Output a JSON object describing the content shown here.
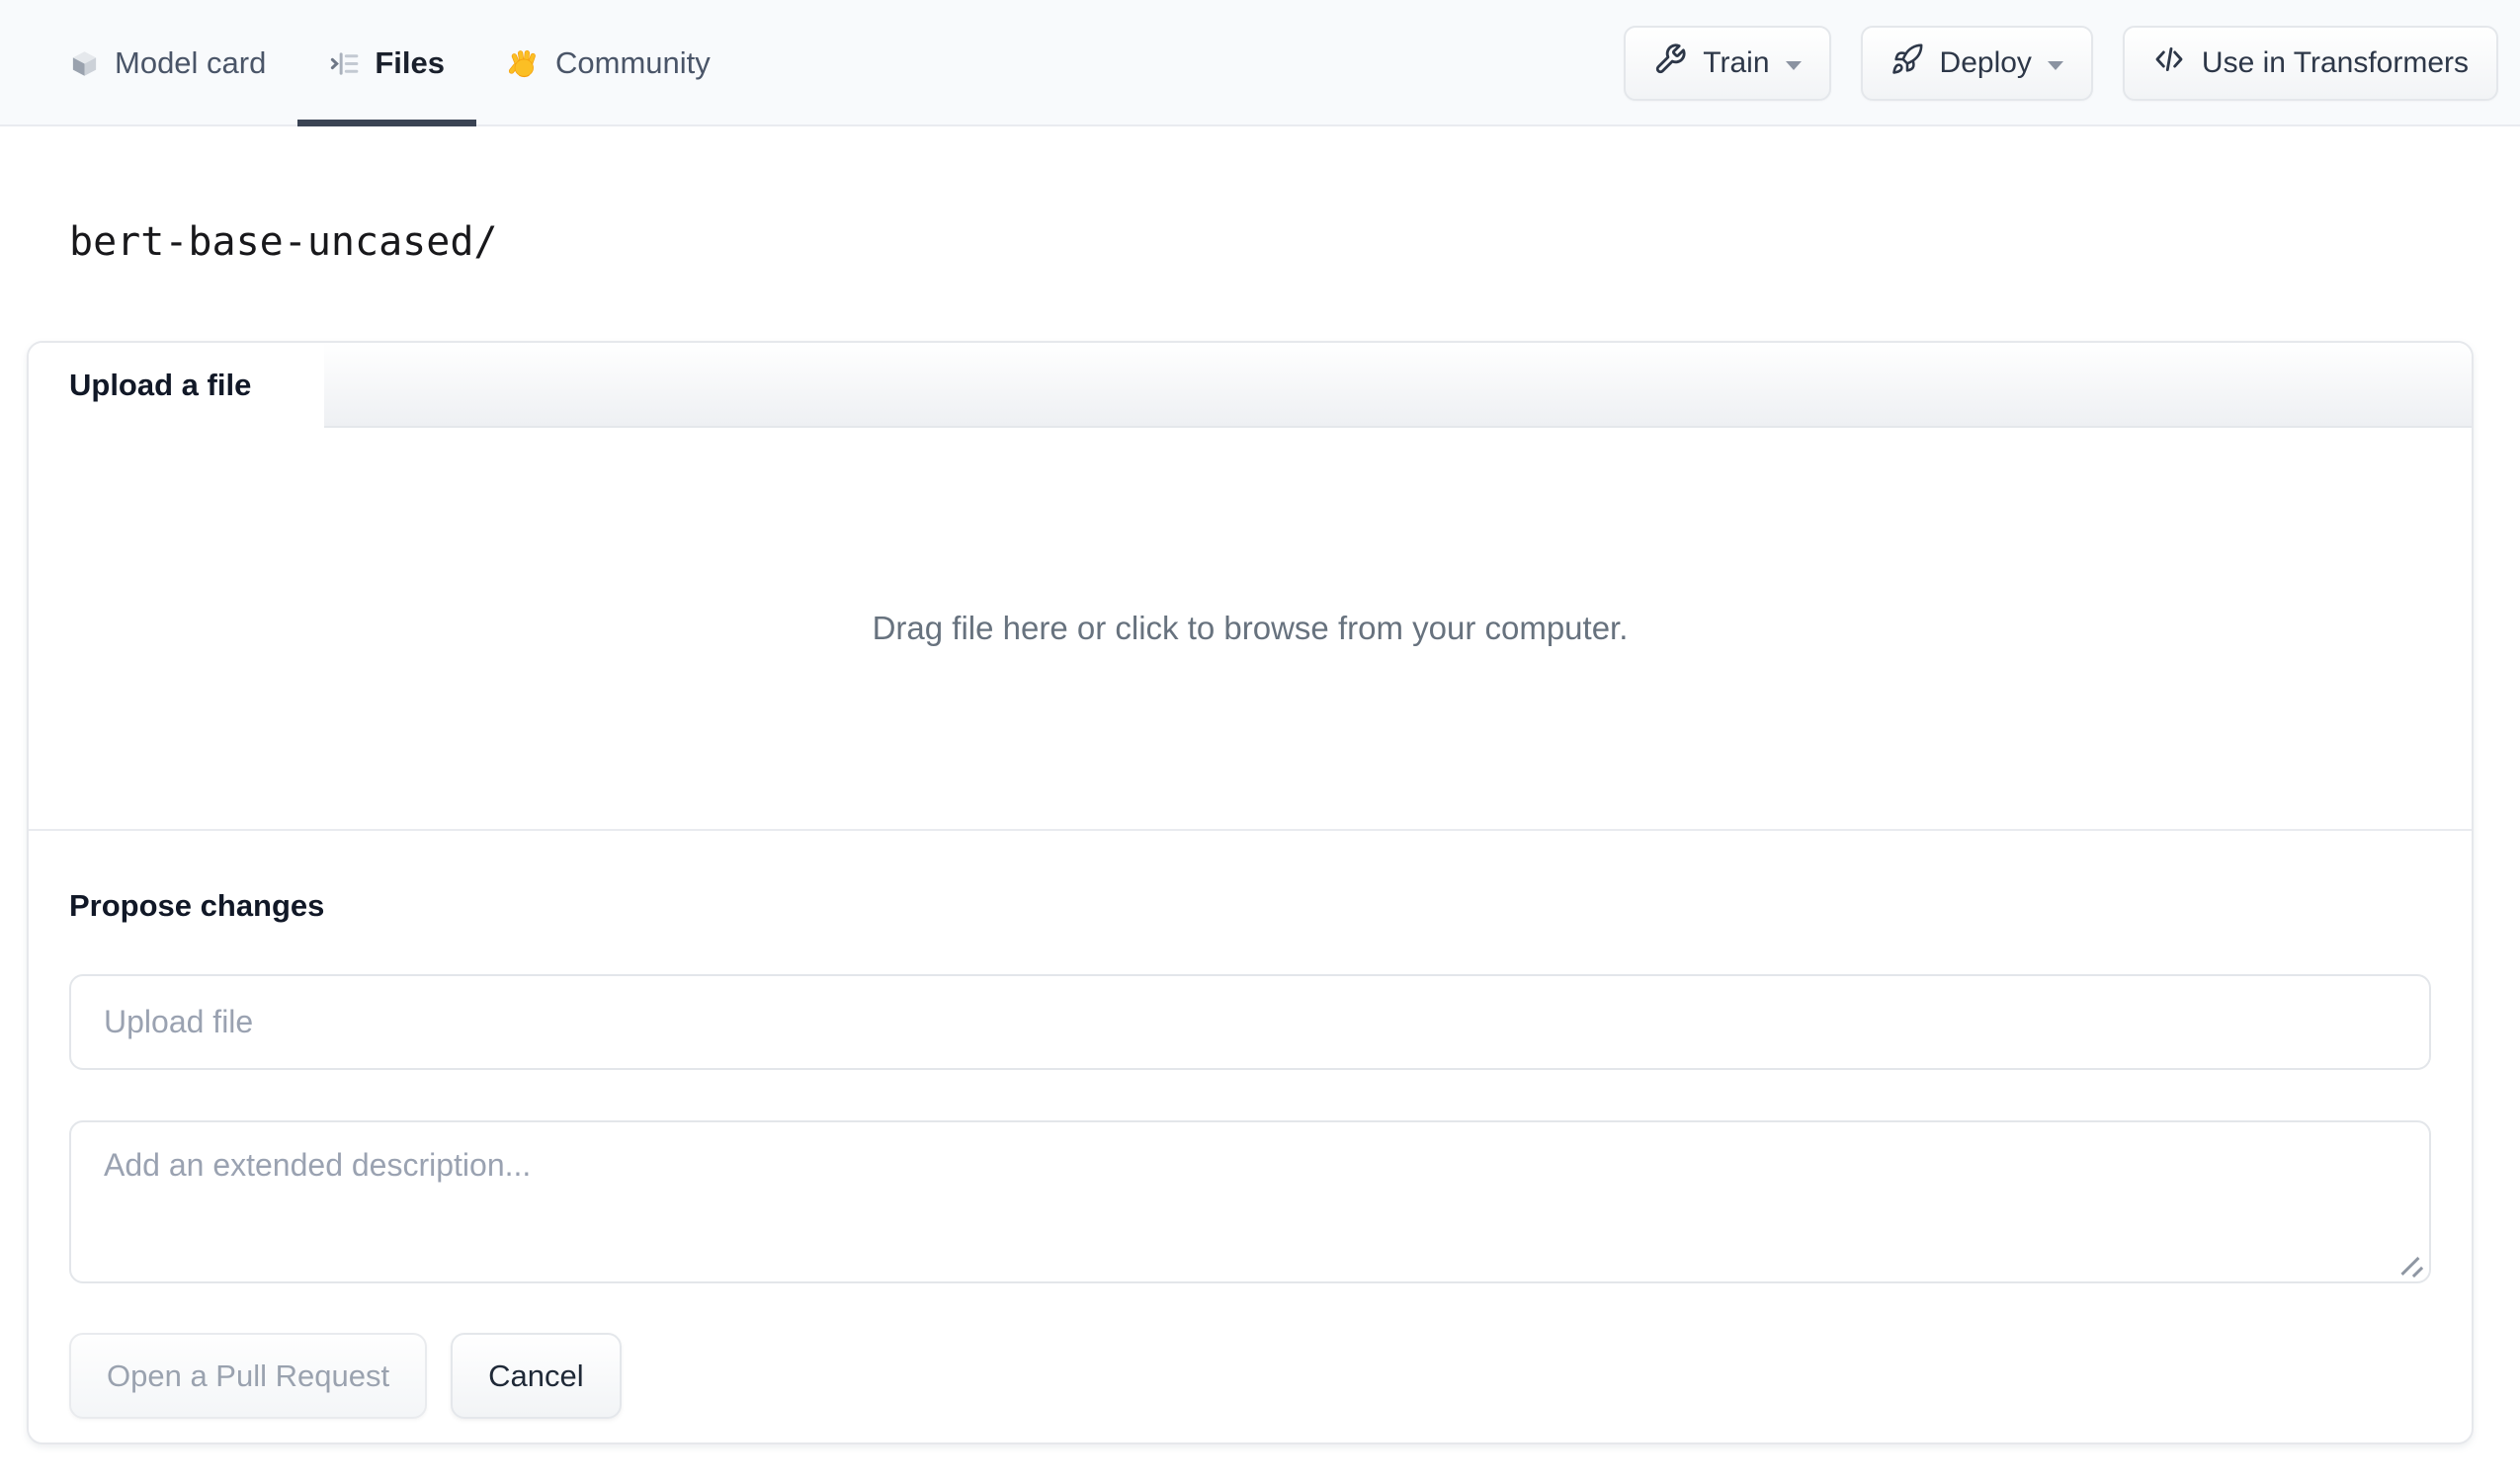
{
  "header": {
    "tabs": [
      {
        "label": "Model card",
        "icon": "cube-icon",
        "active": false
      },
      {
        "label": "Files",
        "icon": "files-list-icon",
        "active": true
      },
      {
        "label": "Community",
        "icon": "waving-hand-icon",
        "active": false
      }
    ],
    "actions": [
      {
        "label": "Train",
        "icon": "wrench-icon",
        "has_menu": true
      },
      {
        "label": "Deploy",
        "icon": "rocket-icon",
        "has_menu": true
      },
      {
        "label": "Use in Transformers",
        "icon": "code-icon",
        "has_menu": false
      }
    ]
  },
  "breadcrumb": {
    "path": "bert-base-uncased/"
  },
  "upload_card": {
    "active_tab": "Upload a file",
    "dropzone_hint": "Drag file here or click to browse from your computer.",
    "propose": {
      "heading": "Propose changes",
      "file_input_placeholder": "Upload file",
      "description_placeholder": "Add an extended description...",
      "submit_label": "Open a Pull Request",
      "cancel_label": "Cancel"
    }
  },
  "icons": {
    "model_card": "cube-icon",
    "files": "files-list-icon",
    "community": "waving-hand-icon",
    "train": "wrench-icon",
    "deploy": "rocket-icon",
    "use_in_transformers": "code-icon",
    "dropdown": "caret-down-icon",
    "textarea_corner": "resize-handle-icon"
  },
  "colors": {
    "header_bg": "#f8fafc",
    "active_tab_underline": "#3a4353",
    "border": "#e6e8ec",
    "text_dark": "#1f2937",
    "text_muted": "#4a5568",
    "dropzone_text": "#67727e",
    "placeholder": "#9aa2b1",
    "disabled_button_text": "#9aa2af",
    "hand_yellow": "#fbbf24"
  }
}
